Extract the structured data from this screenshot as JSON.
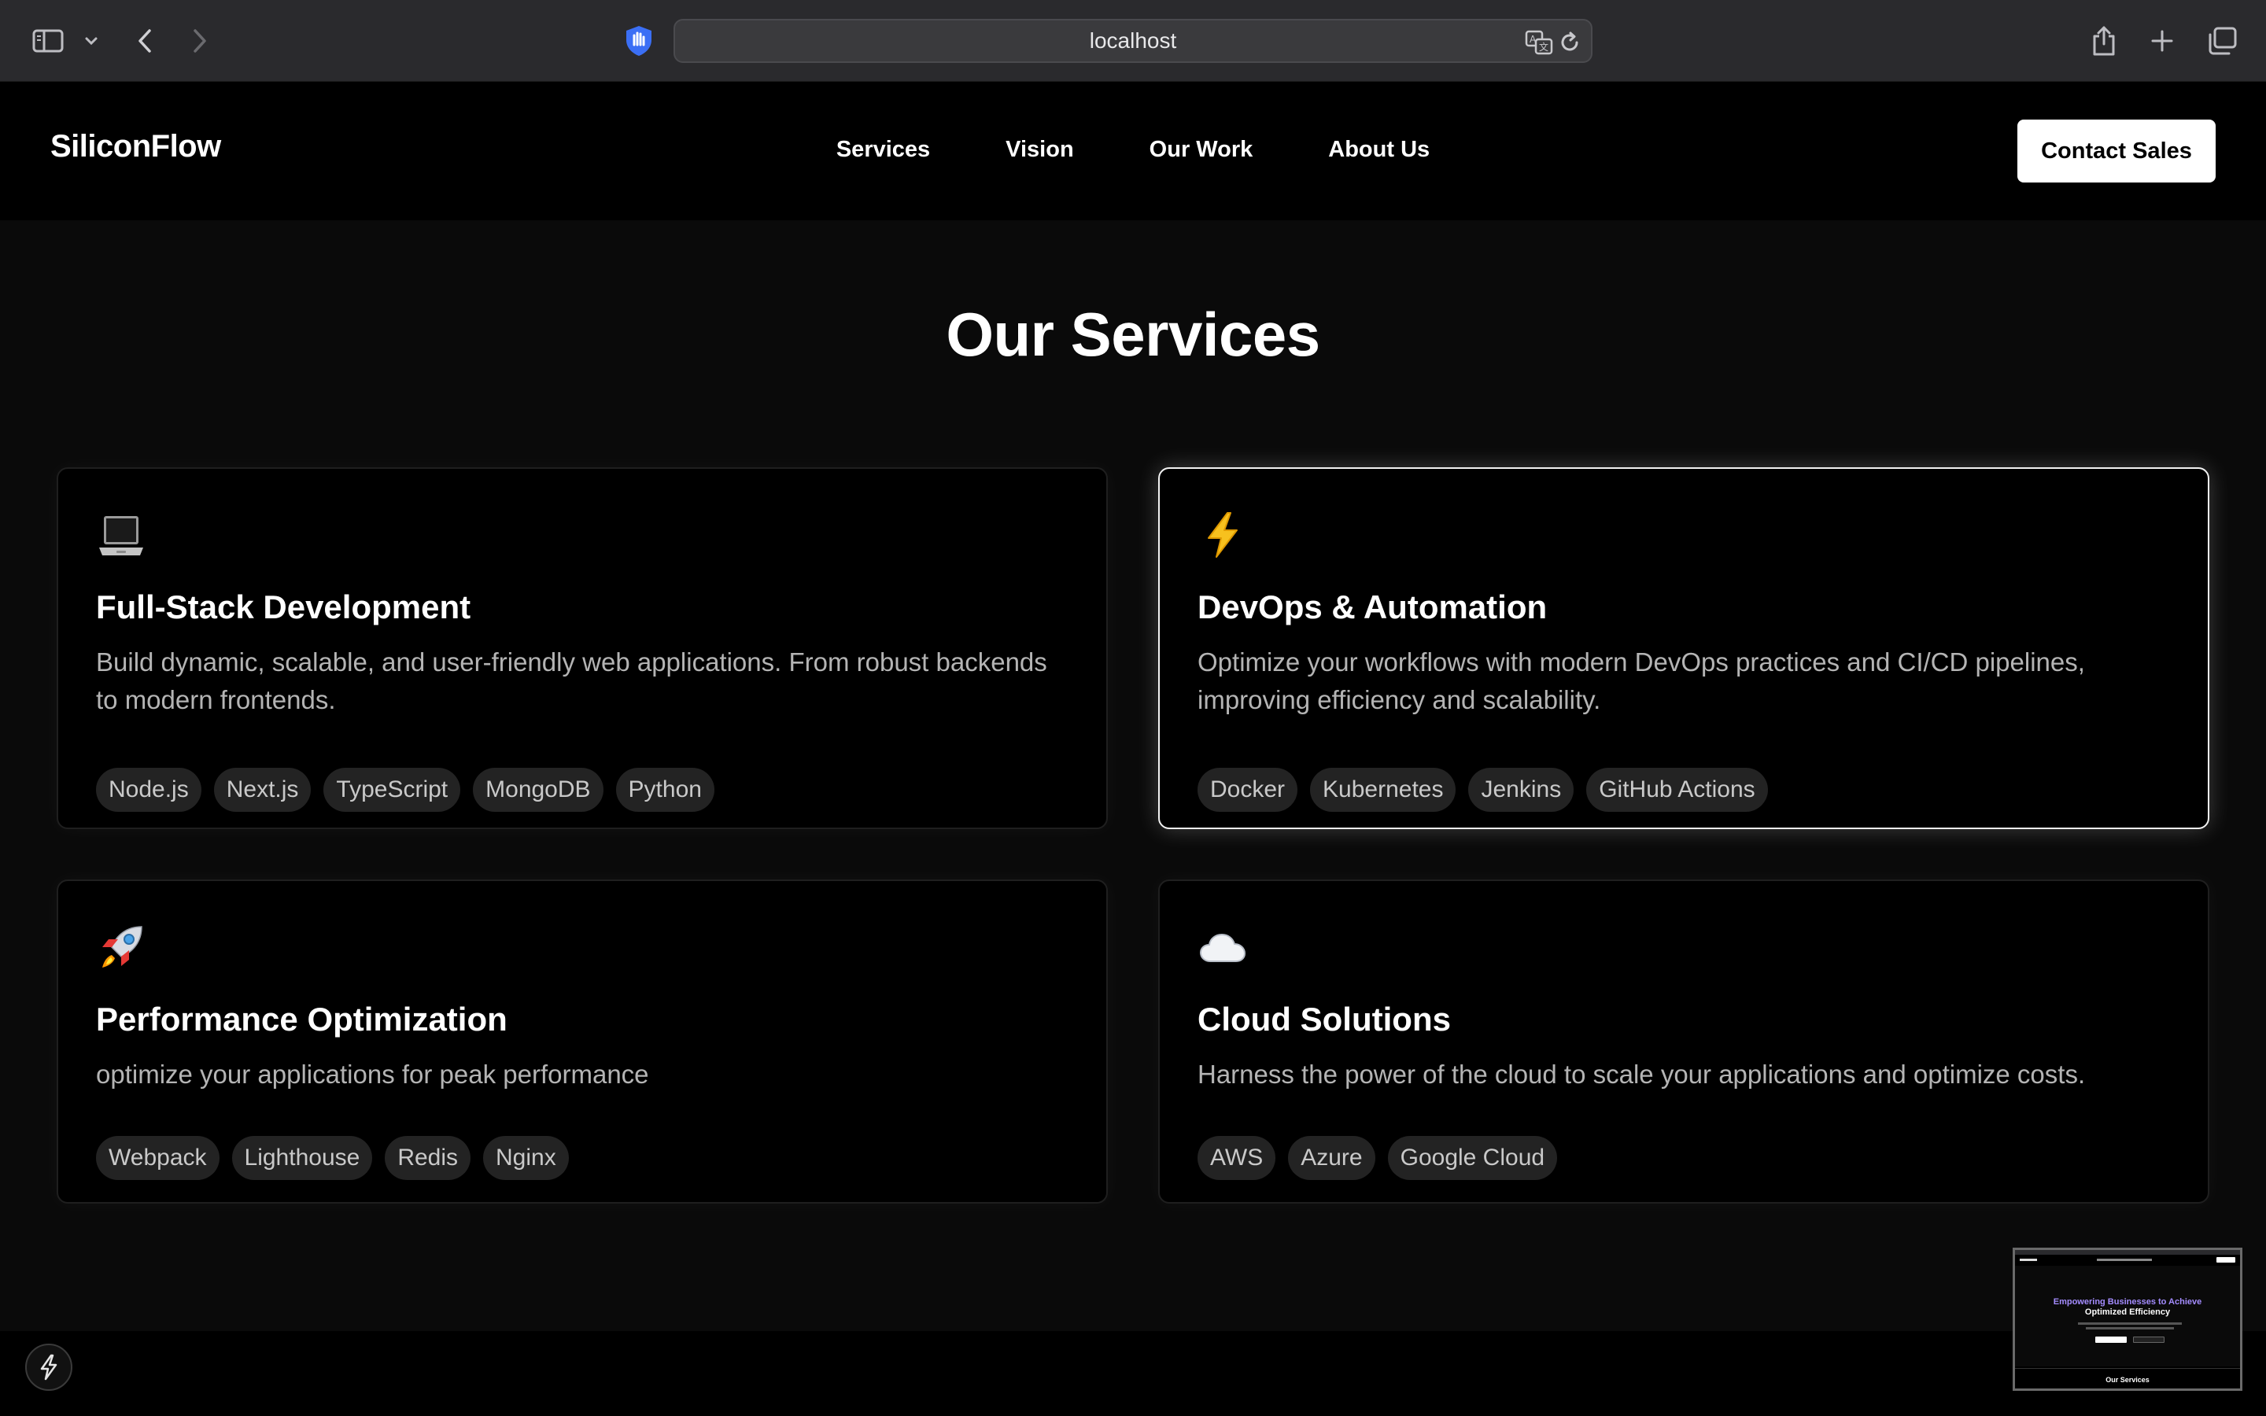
{
  "browser": {
    "url": "localhost",
    "icons": {
      "sidebar": "sidebar-icon",
      "sidebar_menu": "chevron-down-icon",
      "back": "chevron-left-icon",
      "forward": "chevron-right-icon",
      "privacy": "privacy-shield-icon",
      "translate": "translate-icon",
      "reload": "reload-icon",
      "share": "share-icon",
      "new_tab": "plus-icon",
      "tabs": "tab-overview-icon"
    }
  },
  "header": {
    "brand": "SiliconFlow",
    "nav": [
      "Services",
      "Vision",
      "Our Work",
      "About Us"
    ],
    "cta": "Contact Sales"
  },
  "services": {
    "title": "Our Services",
    "cards": [
      {
        "icon": "laptop-icon",
        "title": "Full-Stack Development",
        "desc": "Build dynamic, scalable, and user-friendly web applications. From robust backends to modern frontends.",
        "tags": [
          "Node.js",
          "Next.js",
          "TypeScript",
          "MongoDB",
          "Python"
        ]
      },
      {
        "icon": "lightning-icon",
        "title": "DevOps & Automation",
        "desc": "Optimize your workflows with modern DevOps practices and CI/CD pipelines, improving efficiency and scalability.",
        "tags": [
          "Docker",
          "Kubernetes",
          "Jenkins",
          "GitHub Actions"
        ]
      },
      {
        "icon": "rocket-icon",
        "title": "Performance Optimization",
        "desc": "optimize your applications for peak performance",
        "tags": [
          "Webpack",
          "Lighthouse",
          "Redis",
          "Nginx"
        ]
      },
      {
        "icon": "cloud-icon",
        "title": "Cloud Solutions",
        "desc": "Harness the power of the cloud to scale your applications and optimize costs.",
        "tags": [
          "AWS",
          "Azure",
          "Google Cloud"
        ]
      }
    ]
  },
  "preview": {
    "heading_accent": "Empowering Businesses to Achieve",
    "heading": "Optimized Efficiency",
    "footer_title": "Our Services"
  },
  "colors": {
    "page_bg": "#0a0a0a",
    "header_bg": "#000000",
    "card_bg": "#000000",
    "tag_bg": "#232323",
    "accent_gradient_start": "#7b6cff",
    "accent_gradient_end": "#c86dd7"
  }
}
